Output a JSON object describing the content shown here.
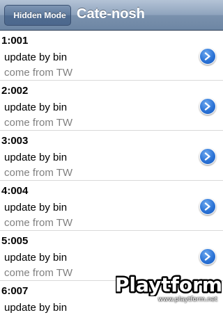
{
  "navbar": {
    "back_label": "Hidden Mode",
    "title": "Cate-nosh"
  },
  "rows": [
    {
      "title": "1:001",
      "update": "update by bin",
      "source": "come from TW"
    },
    {
      "title": "2:002",
      "update": "update by bin",
      "source": "come from TW"
    },
    {
      "title": "3:003",
      "update": "update by bin",
      "source": "come from TW"
    },
    {
      "title": "4:004",
      "update": "update by bin",
      "source": "come from TW"
    },
    {
      "title": "5:005",
      "update": "update by bin",
      "source": "come from TW"
    },
    {
      "title": "6:007",
      "update": "update by bin",
      "source": ""
    }
  ],
  "icons": {
    "row_accessory": "disclosure-chevron-icon"
  },
  "watermark": {
    "logo_text": "Playtform",
    "url": "www.playtform.net"
  },
  "colors": {
    "navbar": "#7a91ad",
    "accessory": "#2b73d6",
    "secondary_text": "#808080"
  }
}
